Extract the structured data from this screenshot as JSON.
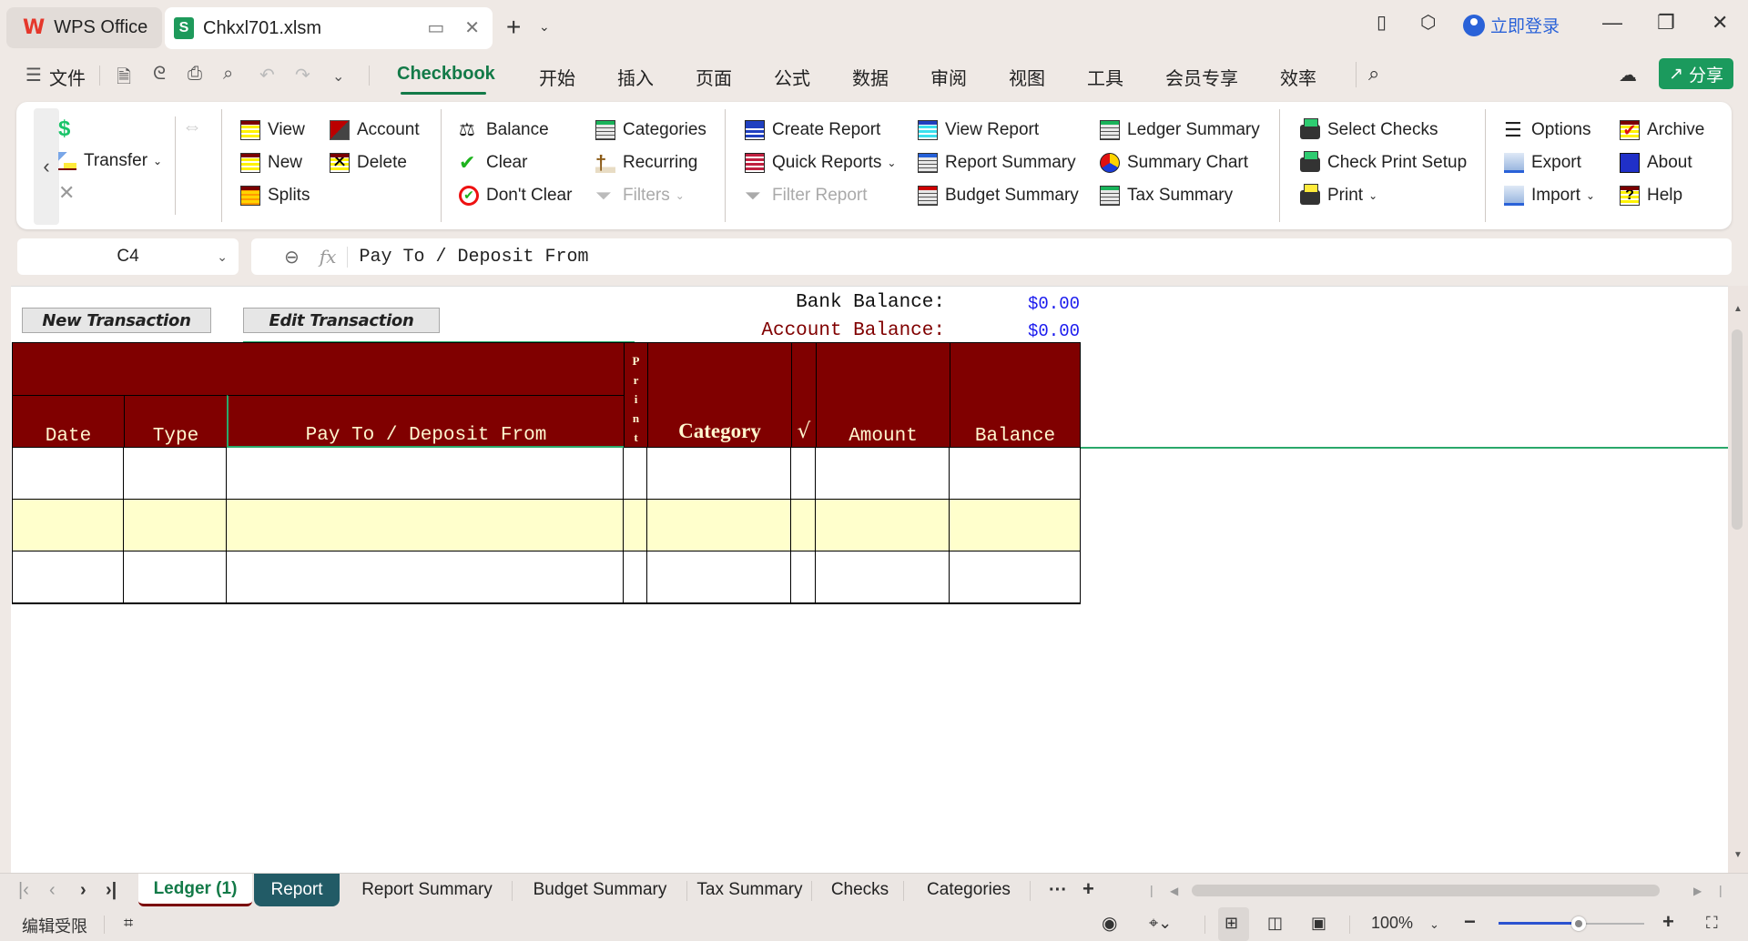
{
  "window": {
    "home_tab_label": "WPS Office",
    "file_tab_label": "Chkxl701.xlsm",
    "login_label": "立即登录",
    "share_label": "分享"
  },
  "menu": {
    "file_label": "文件",
    "tabs": [
      {
        "label": "Checkbook",
        "active": true
      },
      {
        "label": "开始"
      },
      {
        "label": "插入"
      },
      {
        "label": "页面"
      },
      {
        "label": "公式"
      },
      {
        "label": "数据"
      },
      {
        "label": "审阅"
      },
      {
        "label": "视图"
      },
      {
        "label": "工具"
      },
      {
        "label": "会员专享"
      },
      {
        "label": "效率"
      }
    ]
  },
  "ribbon": {
    "transfer": "Transfer",
    "view": "View",
    "new": "New",
    "splits": "Splits",
    "account": "Account",
    "delete": "Delete",
    "balance": "Balance",
    "clear": "Clear",
    "dont_clear": "Don't Clear",
    "categories": "Categories",
    "recurring": "Recurring",
    "filters": "Filters",
    "create_report": "Create Report",
    "quick_reports": "Quick Reports",
    "filter_report": "Filter Report",
    "view_report": "View Report",
    "report_summary": "Report Summary",
    "budget_summary": "Budget Summary",
    "ledger_summary": "Ledger Summary",
    "summary_chart": "Summary Chart",
    "tax_summary": "Tax Summary",
    "select_checks": "Select Checks",
    "check_print_setup": "Check Print Setup",
    "print": "Print",
    "options": "Options",
    "export": "Export",
    "import": "Import",
    "archive": "Archive",
    "about": "About",
    "help": "Help"
  },
  "formula_bar": {
    "cell_ref": "C4",
    "fx_label": "fx",
    "content": "Pay To / Deposit From"
  },
  "sheet": {
    "new_transaction": "New Transaction",
    "edit_transaction": "Edit Transaction",
    "bank_balance_label": "Bank Balance:",
    "bank_balance_value": "$0.00",
    "account_balance_label": "Account Balance:",
    "account_balance_value": "$0.00",
    "columns": {
      "date": "Date",
      "type": "Type",
      "payee": "Pay To / Deposit From",
      "print": "Print",
      "category": "Category",
      "cleared": "√",
      "amount": "Amount",
      "balance": "Balance"
    },
    "rows": [
      {
        "date": "",
        "type": "",
        "payee": "",
        "print": "",
        "category": "",
        "cleared": "",
        "amount": "",
        "balance": ""
      },
      {
        "date": "",
        "type": "",
        "payee": "",
        "print": "",
        "category": "",
        "cleared": "",
        "amount": "",
        "balance": ""
      },
      {
        "date": "",
        "type": "",
        "payee": "",
        "print": "",
        "category": "",
        "cleared": "",
        "amount": "",
        "balance": ""
      }
    ],
    "colors": {
      "header_bg": "#800000",
      "header_text": "#fff6cf",
      "alt_row": "#ffffcc",
      "balance_value": "#1a1aee",
      "account_label": "#800000"
    }
  },
  "sheet_tabs": [
    {
      "label": "Ledger (1)",
      "active": true
    },
    {
      "label": "Report"
    },
    {
      "label": "Report Summary"
    },
    {
      "label": "Budget Summary"
    },
    {
      "label": "Tax Summary"
    },
    {
      "label": "Checks"
    },
    {
      "label": "Categories"
    }
  ],
  "status": {
    "edit_restricted": "编辑受限",
    "zoom_level": "100%",
    "zoom_fraction": 0.55
  }
}
